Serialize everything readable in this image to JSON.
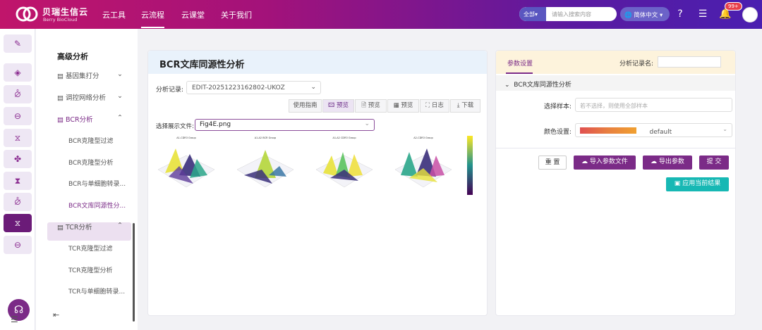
{
  "brand": {
    "name": "贝瑞生信云",
    "sub": "Berry BioCloud"
  },
  "nav": [
    "云工具",
    "云流程",
    "云课堂",
    "关于我们"
  ],
  "search": {
    "scope": "全部▾",
    "placeholder": "请输入搜索内容"
  },
  "lang": "简体中文 ▾",
  "badge": "99+",
  "sidebar": {
    "title": "高级分析",
    "items": [
      {
        "label": "基因集打分",
        "arrow": "⌄"
      },
      {
        "label": "调控网络分析",
        "arrow": "⌄"
      },
      {
        "label": "BCR分析",
        "arrow": "⌃"
      },
      {
        "label": "BCR克隆型过滤"
      },
      {
        "label": "BCR克隆型分析"
      },
      {
        "label": "BCR与单细胞转录..."
      },
      {
        "label": "BCR文库同源性分..."
      },
      {
        "label": "TCR分析",
        "arrow": "⌃"
      },
      {
        "label": "TCR克隆型过滤"
      },
      {
        "label": "TCR克隆型分析"
      },
      {
        "label": "TCR与单细胞转录..."
      }
    ]
  },
  "main": {
    "title": "BCR文库同源性分析",
    "record_label": "分析记录:",
    "record_value": "EDIT-20251223162802-UKOZ",
    "toolbar": [
      "使用指南",
      "🖾 预览",
      "🗎 预览",
      "▦ 预览",
      "⛶ 日志",
      "⤓ 下载"
    ],
    "file_label": "选择展示文件:",
    "file_value": "Fig4E.png",
    "plot_titles": [
      "A1-CDR3 Group",
      "A1-A2 BCR Group",
      "A1-A2 CDR3 Group",
      "A2-CDR3 Group"
    ]
  },
  "panel": {
    "tab": "参数设置",
    "record_name": "分析记录名:",
    "section": "BCR文库同源性分析",
    "sample_label": "选择样本:",
    "sample_placeholder": "若不选择，则使用全部样本",
    "color_label": "颜色设置:",
    "color_value": "default",
    "buttons": {
      "reset": "重 置",
      "import": "导入参数文件",
      "export": "导出参数",
      "submit": "提 交",
      "apply": "应用当前结果"
    }
  },
  "colors": {
    "accent": "#7b2b87",
    "teal": "#17b8b4"
  }
}
